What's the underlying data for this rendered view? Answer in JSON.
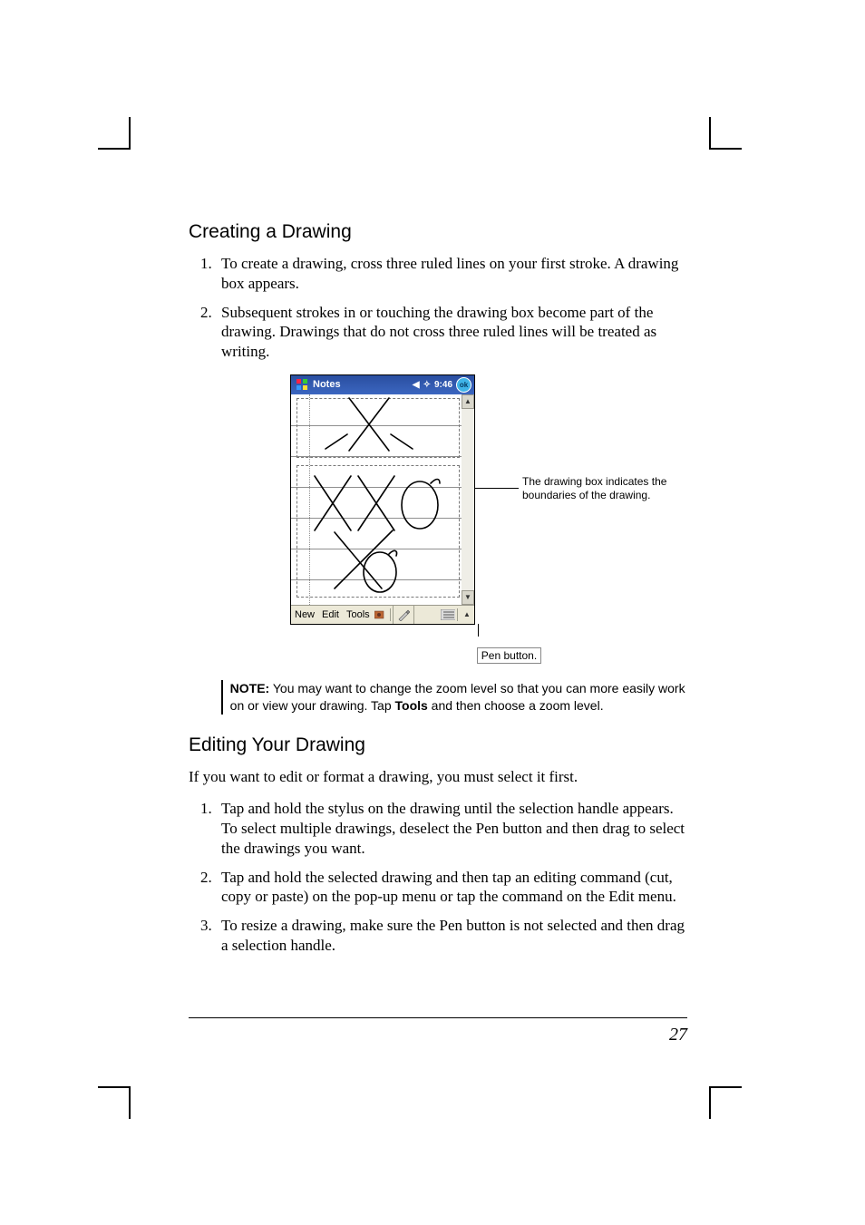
{
  "section1": {
    "heading": "Creating a Drawing",
    "steps": [
      "To create a drawing, cross three ruled lines on your first stroke. A drawing box appears.",
      "Subsequent strokes in or touching the drawing box become part of the drawing. Drawings that do not cross three ruled lines will be treated as writing."
    ]
  },
  "figure": {
    "title": "Notes",
    "time": "9:46",
    "ok": "ok",
    "menu_new": "New",
    "menu_edit": "Edit",
    "menu_tools": "Tools",
    "callout": "The drawing box indicates the boundaries of the drawing.",
    "pen_label": "Pen button."
  },
  "note": {
    "prefix": "NOTE:",
    "body_before": " You may want to change the zoom level so that you can more easily work on or view your drawing. Tap ",
    "bold": "Tools",
    "body_after": " and then choose a zoom level."
  },
  "section2": {
    "heading": "Editing Your Drawing",
    "intro": "If you want to edit or format a drawing, you must select it first.",
    "steps": [
      "Tap and hold the stylus on the drawing until the selection handle appears. To select multiple drawings, deselect the Pen button and then drag to select the drawings you want.",
      "Tap and hold the selected drawing and then tap an editing command (cut, copy or paste) on the pop-up menu or tap the command on the Edit menu.",
      "To resize a drawing, make sure the Pen button is not selected and then drag a selection handle."
    ]
  },
  "page_number": "27"
}
